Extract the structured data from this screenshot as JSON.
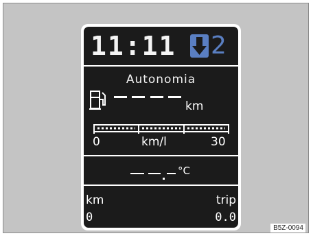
{
  "header": {
    "clock": "11:11",
    "gear_recommendation": "2",
    "shift_direction_icon": "arrow-down-icon"
  },
  "range": {
    "title": "Autonomia",
    "value": "----",
    "unit": "km",
    "fuel_icon": "fuel-pump-icon"
  },
  "consumption": {
    "scale_min": "0",
    "unit": "km/l",
    "scale_max": "30"
  },
  "temperature": {
    "value": "--.-",
    "unit": "°C"
  },
  "odometer": {
    "total_label": "km",
    "total_value": "0",
    "trip_label": "trip",
    "trip_value": "0.0"
  },
  "reference_code": "B5Z-0094",
  "colors": {
    "screen_bg": "#1b1b1b",
    "text": "#ffffff",
    "accent_blue": "#5a7fc2",
    "surround": "#c4c4c4"
  }
}
